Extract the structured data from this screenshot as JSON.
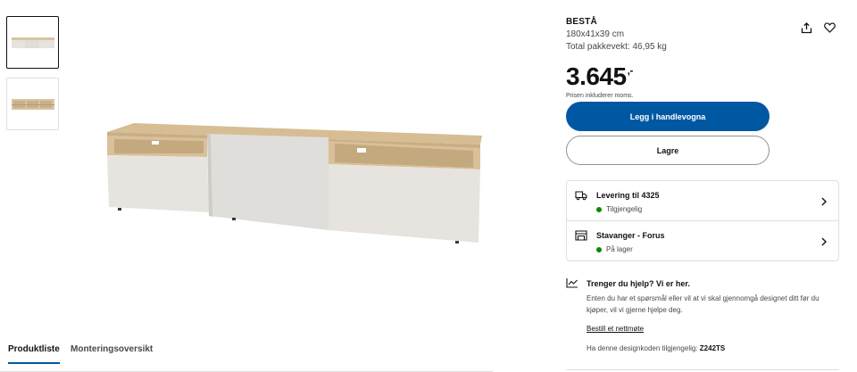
{
  "product": {
    "name": "BESTÅ",
    "dimensions": "180x41x39 cm",
    "package_weight": "Total pakkevekt: 46,95 kg",
    "price": "3.645",
    "price_suffix": ",-",
    "vat_note": "Prisen inkluderer moms."
  },
  "actions": {
    "add_to_cart": "Legg i handlevogna",
    "save": "Lagre",
    "share_icon": "share-icon",
    "favorite_icon": "heart-icon"
  },
  "availability": [
    {
      "icon": "truck-icon",
      "title": "Levering til 4325",
      "status": "Tilgjengelig",
      "status_color": "#0a8a00"
    },
    {
      "icon": "store-icon",
      "title": "Stavanger - Forus",
      "status": "På lager",
      "status_color": "#0a8a00"
    }
  ],
  "help": {
    "icon": "graph-icon",
    "title": "Trenger du hjelp? Vi er her.",
    "body": "Enten du har et spørsmål eller vil at vi skal gjennomgå designet ditt før du kjøper, vil vi gjerne hjelpe deg.",
    "link": "Bestill et nettmøte",
    "code_prefix": "Ha denne designkoden tilgjengelig:",
    "code": "Z242TS"
  },
  "tabs": [
    {
      "label": "Produktliste",
      "active": true
    },
    {
      "label": "Monteringsoversikt",
      "active": false
    }
  ],
  "colors": {
    "primary": "#0058a3",
    "available": "#0a8a00"
  }
}
